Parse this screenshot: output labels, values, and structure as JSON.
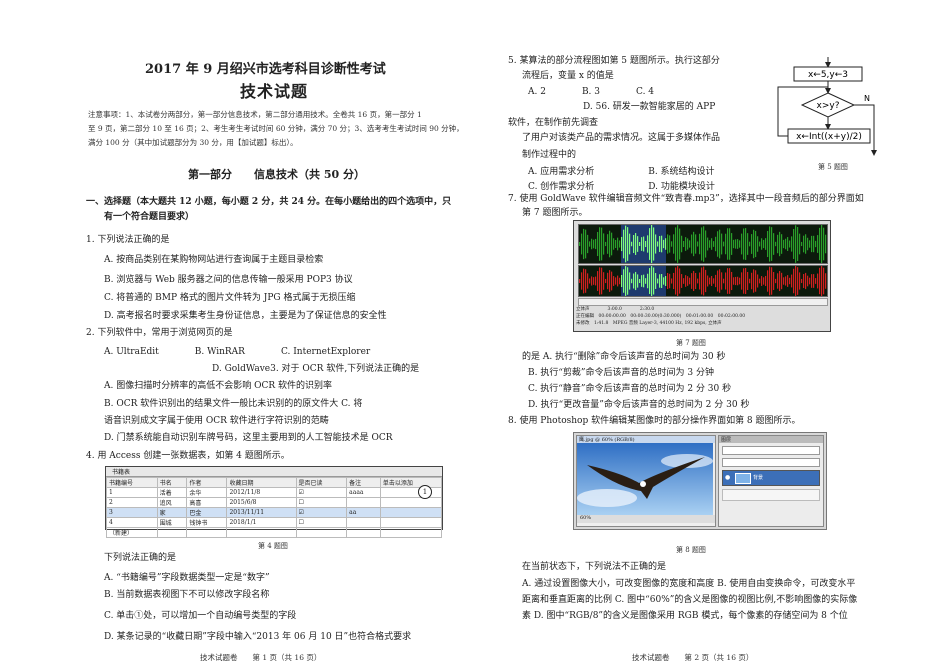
{
  "header": {
    "exam_title": "2017 年 9 月绍兴市选考科目诊断性考试",
    "subject": "技术试题",
    "notes_1": "注意事项：1、本试卷分两部分，第一部分信息技术，第二部分通用技术。全卷共 16 页，第一部分 1",
    "notes_2": "至 9 页，第二部分 10 至 16 页；2、考生考生考试时间 60 分钟，满分 70 分；3、选考考生考试时间 90 分钟，",
    "notes_3": "满分 100 分（其中加试题部分为 30 分，用【加试题】标出）。"
  },
  "part1": {
    "title": "第一部分　　信息技术（共 50 分）",
    "section_heading_1": "一、选择题（本大题共 12 小题，每小题 2 分，共 24 分。在每小题给出的四个选项中，只",
    "section_heading_2": "有一个符合题目要求）"
  },
  "left_lines": [
    "1. 下列说法正确的是",
    "A. 按商品类别在某购物网站进行查询属于主题目录检索",
    "B. 浏览器与 Web 服务器之间的信息传输一般采用 POP3 协议",
    "C. 将普通的 BMP 格式的图片文件转为 JPG 格式属于无损压缩",
    "D. 高考报名时要求采集考生身份证信息，主要是为了保证信息的安全性",
    "2. 下列软件中，常用于浏览网页的是",
    "A. UltraEdit　　　　B. WinRAR　　　　C. InternetExplorer",
    "D. GoldWave3. 对于 OCR 软件,下列说法正确的是",
    "A. 图像扫描时分辨率的高低不会影响 OCR 软件的识别率",
    "B. OCR 软件识别出的结果文件一般比未识别的的原文件大 C. 将",
    "语音识别成文字属于使用 OCR 软件进行字符识别的范畴",
    "D. 门禁系统能自动识别车牌号码，这里主要用到的人工智能技术是 OCR",
    "4. 用 Access 创建一张数据表，如第 4 题图所示。",
    "下列说法正确的是",
    "A. “书籍编号”字段数据类型一定是“数字”",
    "B. 当前数据表视图下不可以修改字段名称",
    "C. 单击①处，可以增加一个自动编号类型的字段",
    "D. 某条记录的“收藏日期”字段中输入“2013 年 06 月 10 日”也符合格式要求"
  ],
  "access_table": {
    "tab": "书籍表",
    "headers": [
      "书籍编号",
      "书名",
      "作者",
      "收藏日期",
      "是否已读",
      "备注",
      "单击以添加"
    ],
    "rows": [
      [
        "1",
        "活着",
        "余华",
        "2012/11/8",
        "☑",
        "aaaa",
        ""
      ],
      [
        "2",
        "追风",
        "高喜",
        "2015/6/8",
        "☐",
        "",
        ""
      ],
      [
        "3",
        "家",
        "巴金",
        "2013/11/11",
        "☑",
        "aa",
        ""
      ],
      [
        "4",
        "围城",
        "钱钟书",
        "2018/1/1",
        "☐",
        "",
        ""
      ],
      [
        "（新建）",
        "",
        "",
        "",
        "",
        "",
        ""
      ]
    ],
    "caption": "第 4 题图",
    "marker": "1"
  },
  "right_lines": [
    "5. 某算法的部分流程图如第 5 题图所示。执行这部分",
    "流程后，变量 x 的值是",
    "A. 2　　　　B. 3　　　　C. 4",
    "D. 56. 研发一款智能家居的 APP",
    "软件，在制作前先调查",
    "了用户对该类产品的需求情况。这属于多媒体作品",
    "制作过程中的",
    "A. 应用需求分析　　　　　　B. 系统结构设计",
    "C. 创作需求分析　　　　　　D. 功能模块设计",
    "7. 使用 GoldWave 软件编辑音频文件“致青春.mp3”，选择其中一段音频后的部分界面如",
    "第 7 题图所示。",
    "的是 A. 执行“删除”命令后该声音的总时间为 30 秒",
    "B. 执行“剪裁”命令后该声音的总时间为 3 分钟",
    "C. 执行“静音”命令后该声音的总时间为 2 分 30 秒",
    "D. 执行“更改音量”命令后该声音的总时间为 2 分 30 秒",
    "8. 使用 Photoshop 软件编辑某图像时的部分操作界面如第 8 题图所示。",
    "在当前状态下，下列说法不正确的是",
    "A. 通过设置图像大小，可改变图像的宽度和高度 B. 使用自由变换命令，可改变水平",
    "距离和垂直距离的比例 C. 图中“60%”的含义是图像的视图比例,不影响图像的实际像",
    "素 D. 图中“RGB/8”的含义是图像采用 RGB 模式，每个像素的存储空间为 8 个位"
  ],
  "flowchart": {
    "box1": "x←5,y←3",
    "decision": "x>y?",
    "no_label": "N",
    "box2": "x←Int((x+y)/2)",
    "caption": "第 5 题图"
  },
  "goldwave": {
    "caption": "第 7 题图",
    "status_1": "立体声　　　　3:00.0　　　　2:30.0",
    "status_2": "正在编辑　00:00:00.00　00:00:30.00(0:30.000)　00:01:00.00　00:02:00.00",
    "status_3": "未修改　1:41.8　MPEG 音频 Layer-3, 44100 Hz, 192 kbps, 立体声"
  },
  "photoshop": {
    "doc_title": "鹰.jpg @ 60% (RGB/8)",
    "zoom": "60%",
    "panel_title": "图层",
    "layer_name": "背景",
    "caption": "第 8 题图"
  },
  "footer": {
    "left": "技术试题卷　　第 1 页（共 16 页）",
    "right": "技术试题卷　　第 2 页（共 16 页）"
  }
}
